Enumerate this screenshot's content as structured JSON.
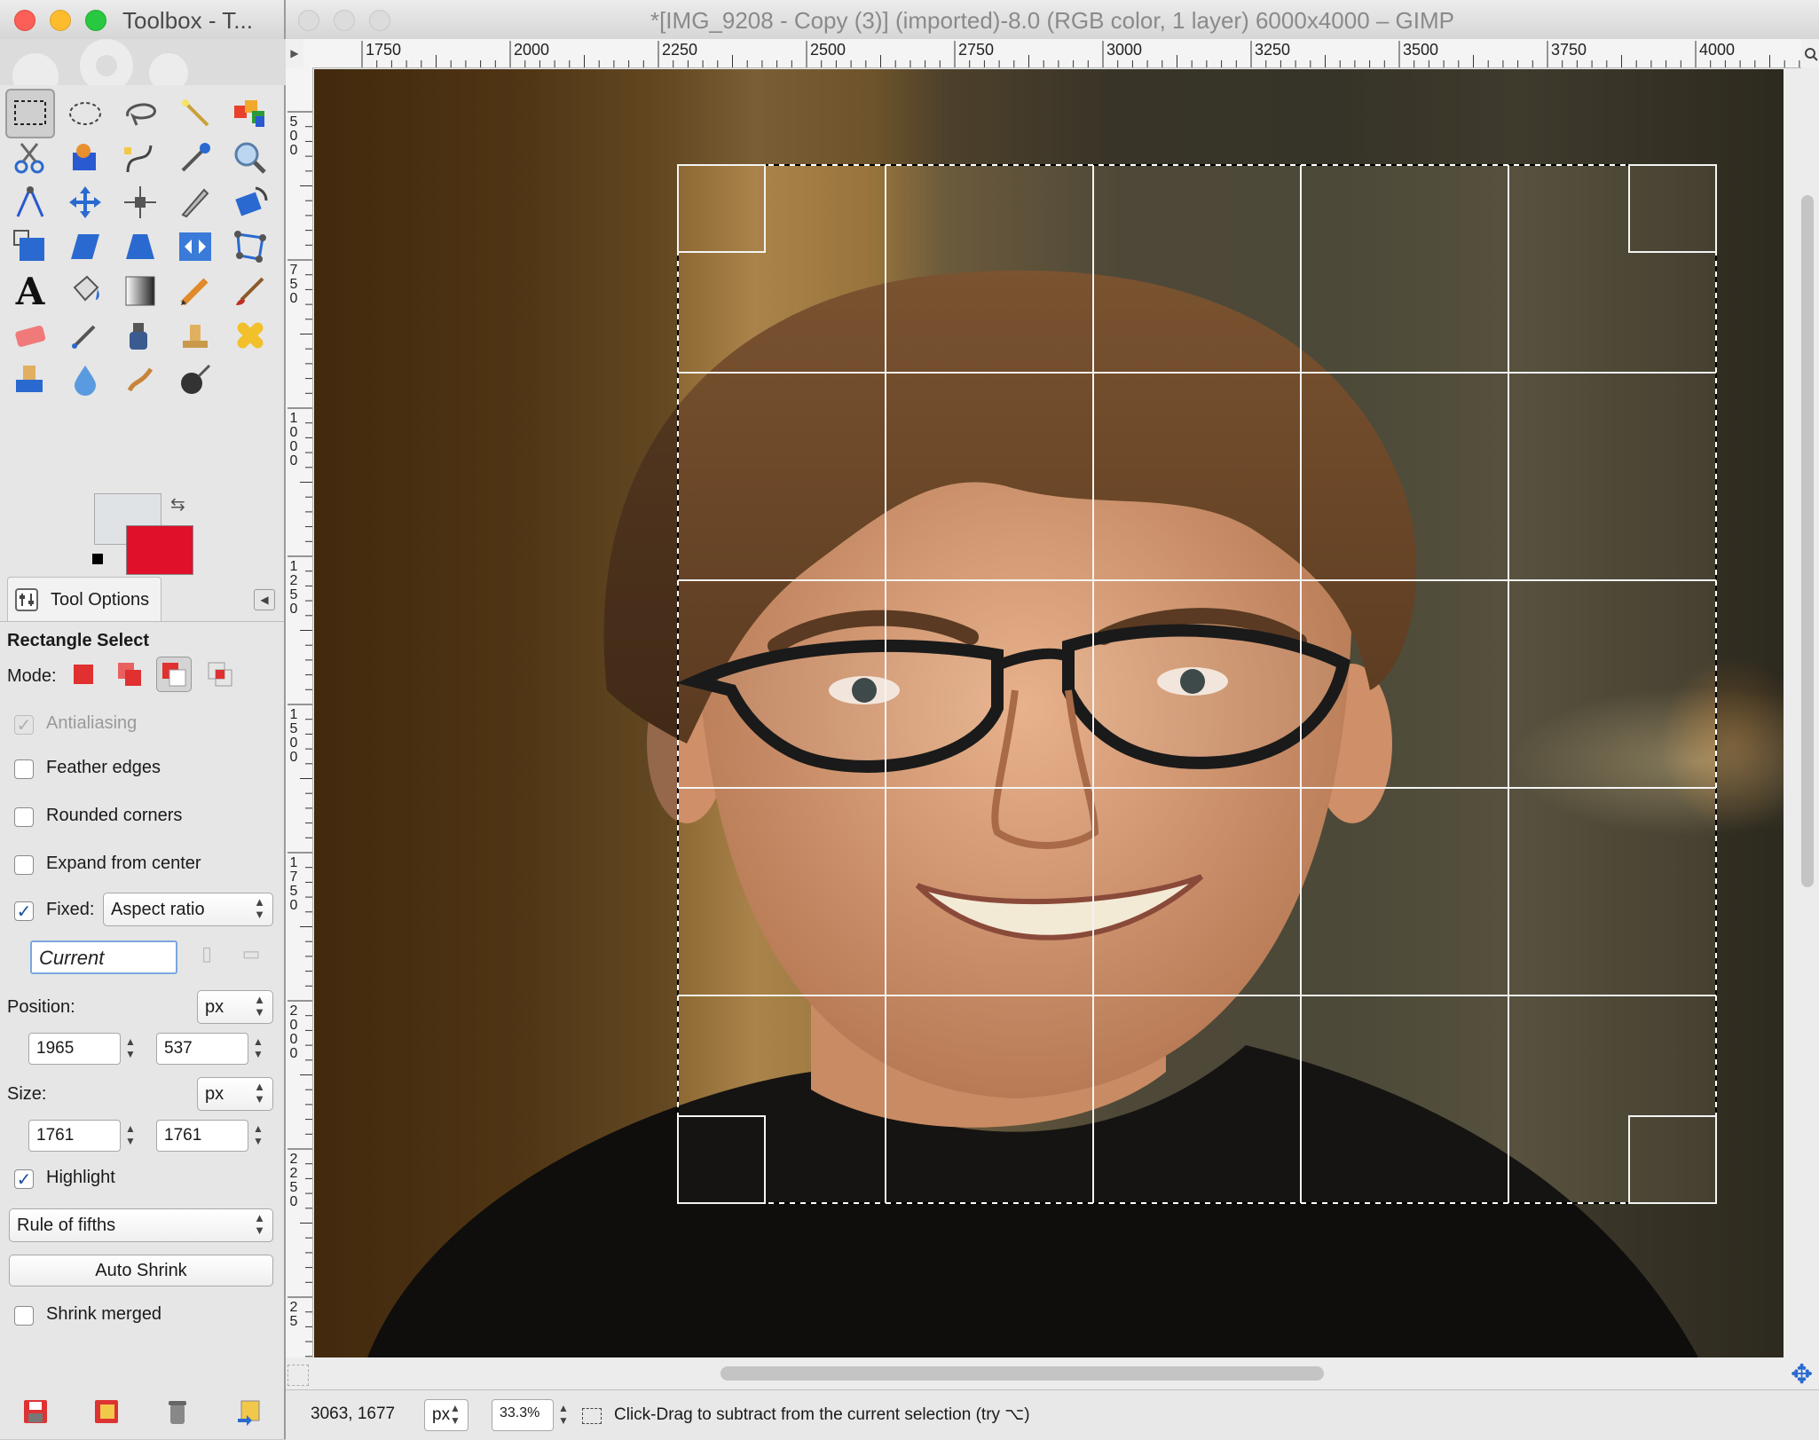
{
  "toolbox": {
    "title": "Toolbox - T...",
    "tool_options_tab": "Tool Options",
    "tool_name": "Rectangle Select",
    "mode_label": "Mode:",
    "antialiasing": {
      "label": "Antialiasing",
      "checked": true,
      "enabled": false
    },
    "feather_edges": {
      "label": "Feather edges",
      "checked": false
    },
    "rounded_corners": {
      "label": "Rounded corners",
      "checked": false
    },
    "expand_from_center": {
      "label": "Expand from center",
      "checked": false
    },
    "fixed": {
      "label": "Fixed:",
      "checked": true,
      "value": "Aspect ratio"
    },
    "aspect_value": "Current",
    "position": {
      "label": "Position:",
      "unit": "px",
      "x": "1965",
      "y": "537"
    },
    "size": {
      "label": "Size:",
      "unit": "px",
      "w": "1761",
      "h": "1761"
    },
    "highlight": {
      "label": "Highlight",
      "checked": true
    },
    "guides": "Rule of fifths",
    "auto_shrink": "Auto Shrink",
    "shrink_merged": {
      "label": "Shrink merged",
      "checked": false
    },
    "fg_color": "#e0102a",
    "bg_color": "#e0e3e6"
  },
  "image_window": {
    "title": "*[IMG_9208 - Copy (3)] (imported)-8.0 (RGB color, 1 layer) 6000x4000 – GIMP",
    "ruler_top_labels": [
      "1750",
      "2000",
      "2250",
      "2500",
      "2750",
      "3000",
      "3250",
      "3500",
      "3750",
      "4000"
    ],
    "ruler_left_labels": [
      "500",
      "750",
      "1000",
      "1250",
      "1500",
      "1750",
      "2000",
      "2250",
      "25"
    ]
  },
  "statusbar": {
    "coords": "3063, 1677",
    "unit": "px",
    "zoom": "33.3%",
    "message": "Click-Drag to subtract from the current selection (try ⌥)"
  }
}
